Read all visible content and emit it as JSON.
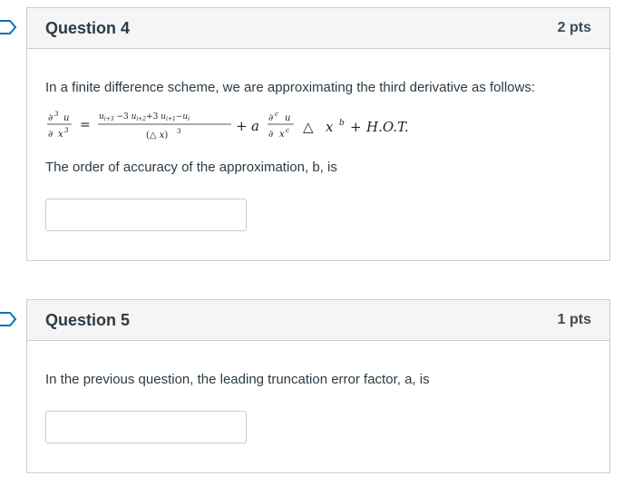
{
  "questions": [
    {
      "title": "Question 4",
      "points": "2 pts",
      "prompt": "In a finite difference scheme, we are approximating the third derivative as follows:",
      "equation": {
        "lhs_num": "∂³ u",
        "lhs_den": "∂ x³",
        "equals": "=",
        "rhs_num": "u",
        "rhs_num_full": "u_{i+3} −3 u_{i+2} +3 u_{i+1} −u_i",
        "rhs_den": "(△ x)³",
        "plus_a": "+ a",
        "err_num": "∂ᶜ u",
        "err_den": "∂ xᶜ",
        "tail": "△ x ᵇ + H.O.T."
      },
      "followup": "The order of accuracy of the approximation, b, is",
      "answer_value": ""
    },
    {
      "title": "Question 5",
      "points": "1 pts",
      "prompt": "In the previous question, the leading truncation error factor, a, is",
      "answer_value": ""
    }
  ],
  "colors": {
    "flag": "#0374b5",
    "header_bg": "#f5f5f5",
    "border": "#c7cdd1",
    "text": "#2d3b45"
  }
}
